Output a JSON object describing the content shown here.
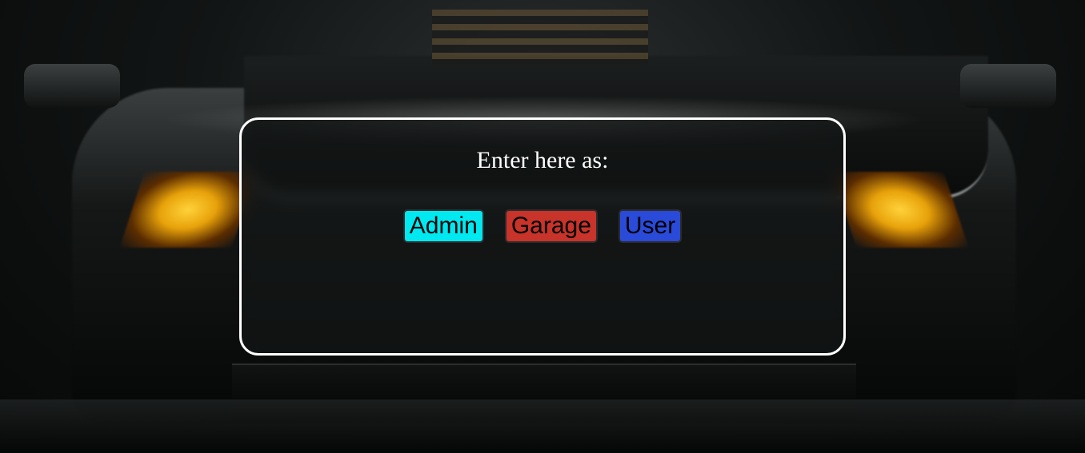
{
  "panel": {
    "title": "Enter here as:"
  },
  "buttons": [
    {
      "label": "Admin",
      "color": "#00e8f0"
    },
    {
      "label": "Garage",
      "color": "#c8332a"
    },
    {
      "label": "User",
      "color": "#2a4ad9"
    }
  ],
  "background": {
    "subject": "black sports car with yellow headlights in rain"
  }
}
